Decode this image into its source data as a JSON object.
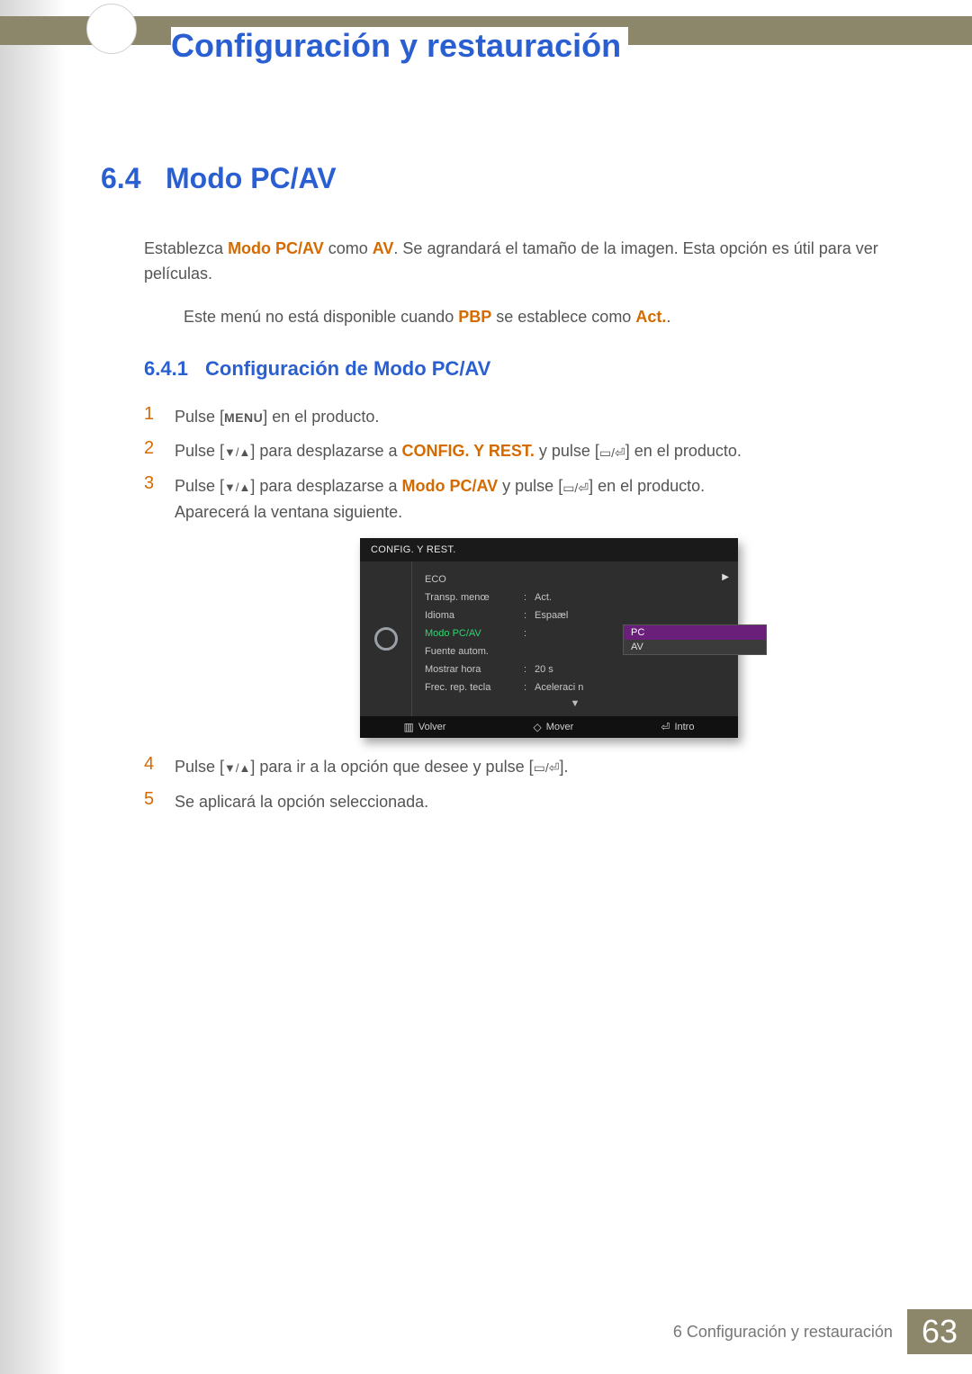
{
  "chapter_title": "Configuración y restauración",
  "section": {
    "number": "6.4",
    "title": "Modo PC/AV"
  },
  "intro": {
    "pre": "Establezca ",
    "hl1": "Modo PC/AV",
    "mid": " como ",
    "hl2": "AV",
    "post": ". Se agrandará el tamaño de la imagen. Esta opción es útil para ver películas."
  },
  "note": {
    "pre": "Este menú no está disponible cuando ",
    "hl1": "PBP",
    "mid": " se establece como ",
    "hl2": "Act.",
    "post": "."
  },
  "subsection": {
    "number": "6.4.1",
    "title": "Configuración de Modo PC/AV"
  },
  "menu_label": "MENU",
  "steps": {
    "s1": {
      "num": "1",
      "a": "Pulse [",
      "b": "] en el producto."
    },
    "s2": {
      "num": "2",
      "a": "Pulse [",
      "b": "] para desplazarse a ",
      "hl": "CONFIG. Y REST.",
      "c": " y pulse [",
      "d": "] en el producto."
    },
    "s3": {
      "num": "3",
      "a": "Pulse [",
      "b": "] para desplazarse a ",
      "hl": "Modo PC/AV",
      "c": " y pulse [",
      "d": "] en el producto.",
      "e": "Aparecerá la ventana siguiente."
    },
    "s4": {
      "num": "4",
      "a": "Pulse [",
      "b": "] para ir a la opción que desee y pulse [",
      "c": "]."
    },
    "s5": {
      "num": "5",
      "a": "Se aplicará la opción seleccionada."
    }
  },
  "osd": {
    "title": "CONFIG. Y REST.",
    "rows": [
      {
        "label": "ECO",
        "val": ""
      },
      {
        "label": "Transp. menœ",
        "val": "Act."
      },
      {
        "label": "Idioma",
        "val": "Espaæl"
      },
      {
        "label": "Modo PC/AV",
        "val": "PC",
        "highlight": true
      },
      {
        "label": "Fuente autom.",
        "val": ""
      },
      {
        "label": "Mostrar hora",
        "val": "20 s"
      },
      {
        "label": "Frec. rep. tecla",
        "val": "Aceleraci n"
      }
    ],
    "dropdown": [
      "PC",
      "AV"
    ],
    "footer": {
      "back": "Volver",
      "move": "Mover",
      "enter": "Intro"
    }
  },
  "footer": {
    "text": "6 Configuración y restauración",
    "page": "63"
  }
}
